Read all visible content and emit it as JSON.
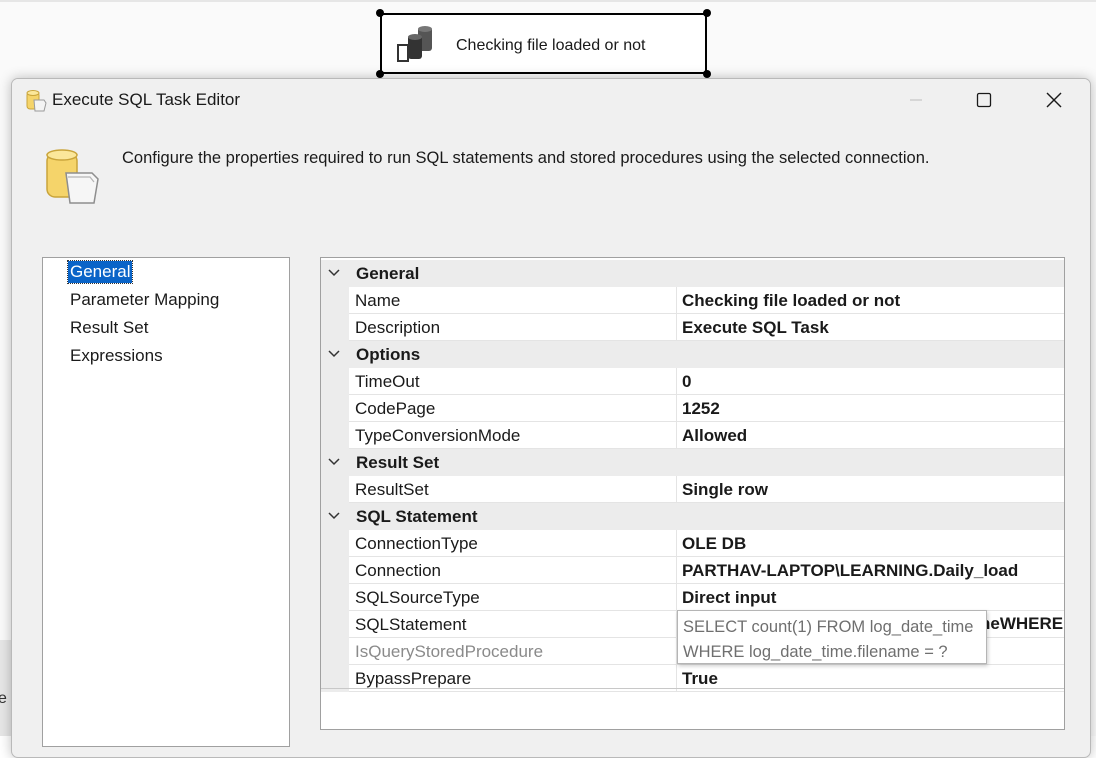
{
  "designer": {
    "task_node_label": "Checking file loaded or not",
    "left_edge_text": "e"
  },
  "dialog": {
    "title": "Execute SQL Task Editor",
    "description": "Configure the properties required to run SQL statements and stored procedures using the selected connection.",
    "window_controls": [
      "minimize",
      "maximize",
      "close"
    ]
  },
  "nav": {
    "items": [
      {
        "label": "General",
        "selected": true
      },
      {
        "label": "Parameter Mapping",
        "selected": false
      },
      {
        "label": "Result Set",
        "selected": false
      },
      {
        "label": "Expressions",
        "selected": false
      }
    ]
  },
  "grid": {
    "categories": [
      {
        "label": "General",
        "properties": [
          {
            "name": "Name",
            "value": "Checking file loaded or not"
          },
          {
            "name": "Description",
            "value": "Execute SQL Task"
          }
        ]
      },
      {
        "label": "Options",
        "properties": [
          {
            "name": "TimeOut",
            "value": "0"
          },
          {
            "name": "CodePage",
            "value": "1252"
          },
          {
            "name": "TypeConversionMode",
            "value": "Allowed"
          }
        ]
      },
      {
        "label": "Result Set",
        "properties": [
          {
            "name": "ResultSet",
            "value": "Single row"
          }
        ]
      },
      {
        "label": "SQL Statement",
        "properties": [
          {
            "name": "ConnectionType",
            "value": "OLE DB"
          },
          {
            "name": "Connection",
            "value": "PARTHAV-LAPTOP\\LEARNING.Daily_load"
          },
          {
            "name": "SQLSourceType",
            "value": "Direct input"
          },
          {
            "name": "SQLStatement",
            "value": "neWHERE"
          },
          {
            "name": "IsQueryStoredProcedure",
            "value": "",
            "disabled": true
          },
          {
            "name": "BypassPrepare",
            "value": "True"
          }
        ]
      }
    ]
  },
  "tooltip": {
    "line1": "SELECT count(1) FROM log_date_time",
    "line2": "WHERE log_date_time.filename = ?"
  },
  "colors": {
    "selection": "#0a64c8",
    "dialog_bg": "#f0f0f0",
    "category_bg": "#ececec"
  }
}
